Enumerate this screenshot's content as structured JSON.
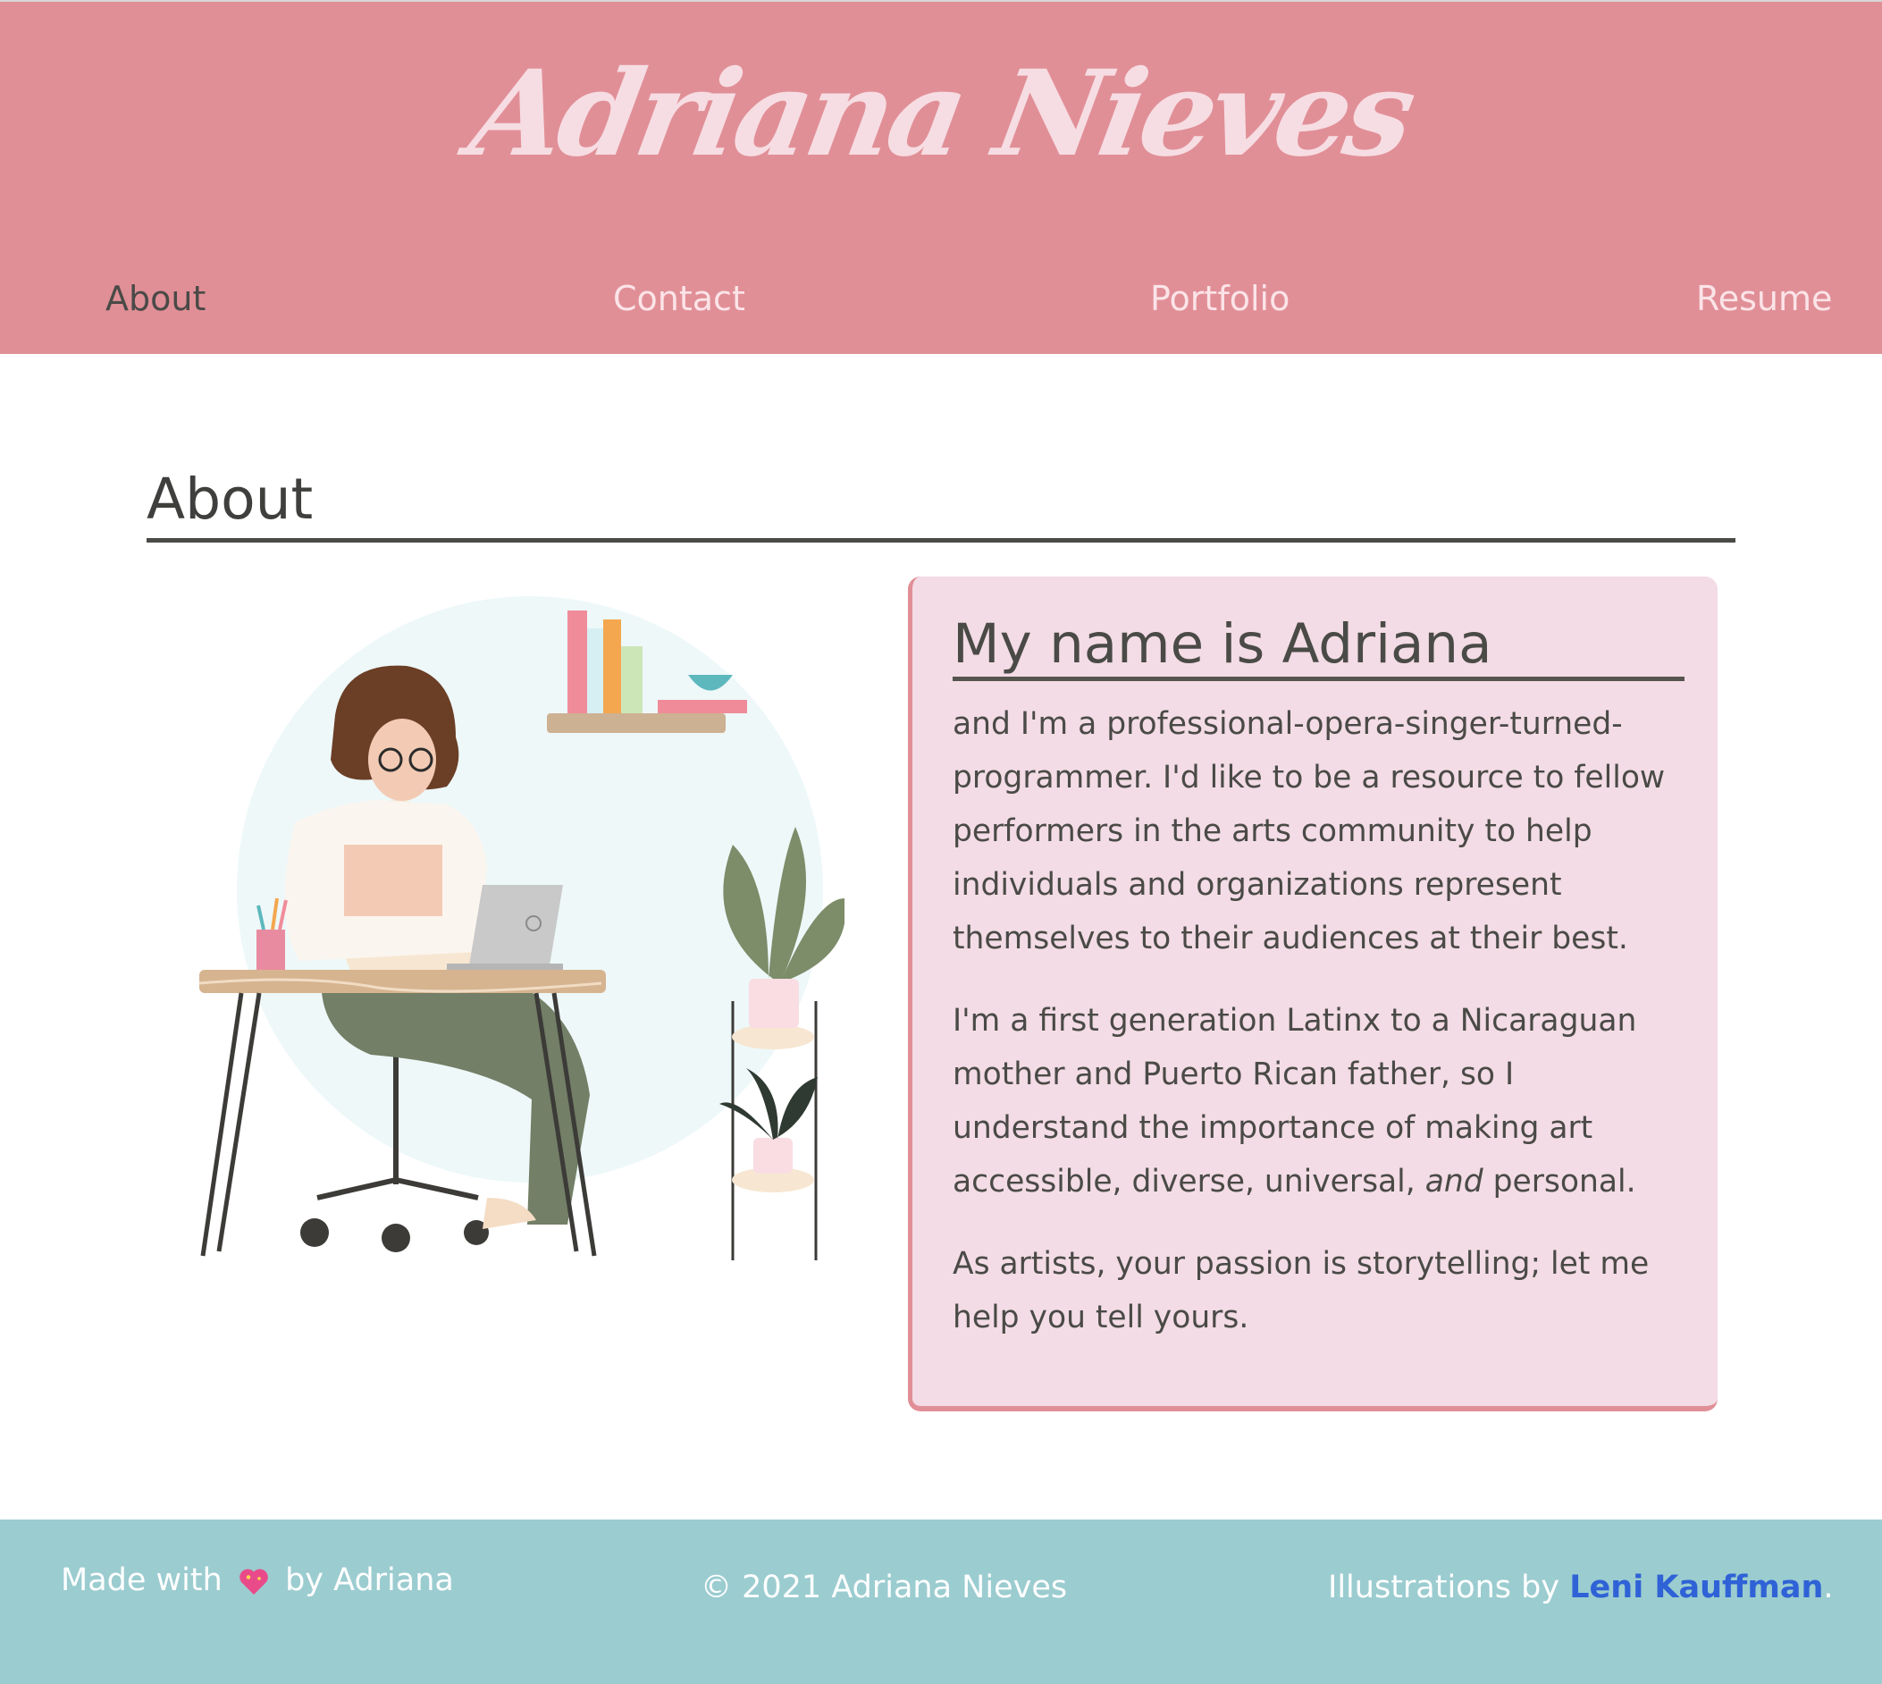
{
  "header": {
    "logo": "Adriana Nieves",
    "nav": [
      {
        "label": "About"
      },
      {
        "label": "Contact"
      },
      {
        "label": "Portfolio"
      },
      {
        "label": "Resume"
      }
    ]
  },
  "about": {
    "title": "About",
    "card": {
      "title": "My name is Adriana",
      "paragraphs": [
        "and I'm a professional-opera-singer-turned-programmer. I'd like to be a resource to fellow performers in the arts community to help individuals and organizations represent themselves to their audiences at their best.",
        "I'm a first generation Latinx to a Nicaraguan mother and Puerto Rican father, so I understand the importance of making art accessible, diverse, universal, ",
        "As artists, your passion is storytelling; let me help you tell yours."
      ],
      "emphasis": "and",
      "paragraph2_end": " personal."
    }
  },
  "footer": {
    "made_prefix": "Made with",
    "made_suffix": "by Adriana",
    "heart_icon": "sparkling-heart-icon",
    "copyright": "© 2021 Adriana Nieves",
    "credit_prefix": "Illustrations by",
    "credit_name": "Leni Kauffman",
    "credit_end": "."
  },
  "colors": {
    "header_bg": "#e18f97",
    "logo": "#f6dde3",
    "card_bg": "#f3dce5",
    "footer_bg": "#9bccd0",
    "link": "#2f62d6",
    "text": "#4a4a47"
  }
}
